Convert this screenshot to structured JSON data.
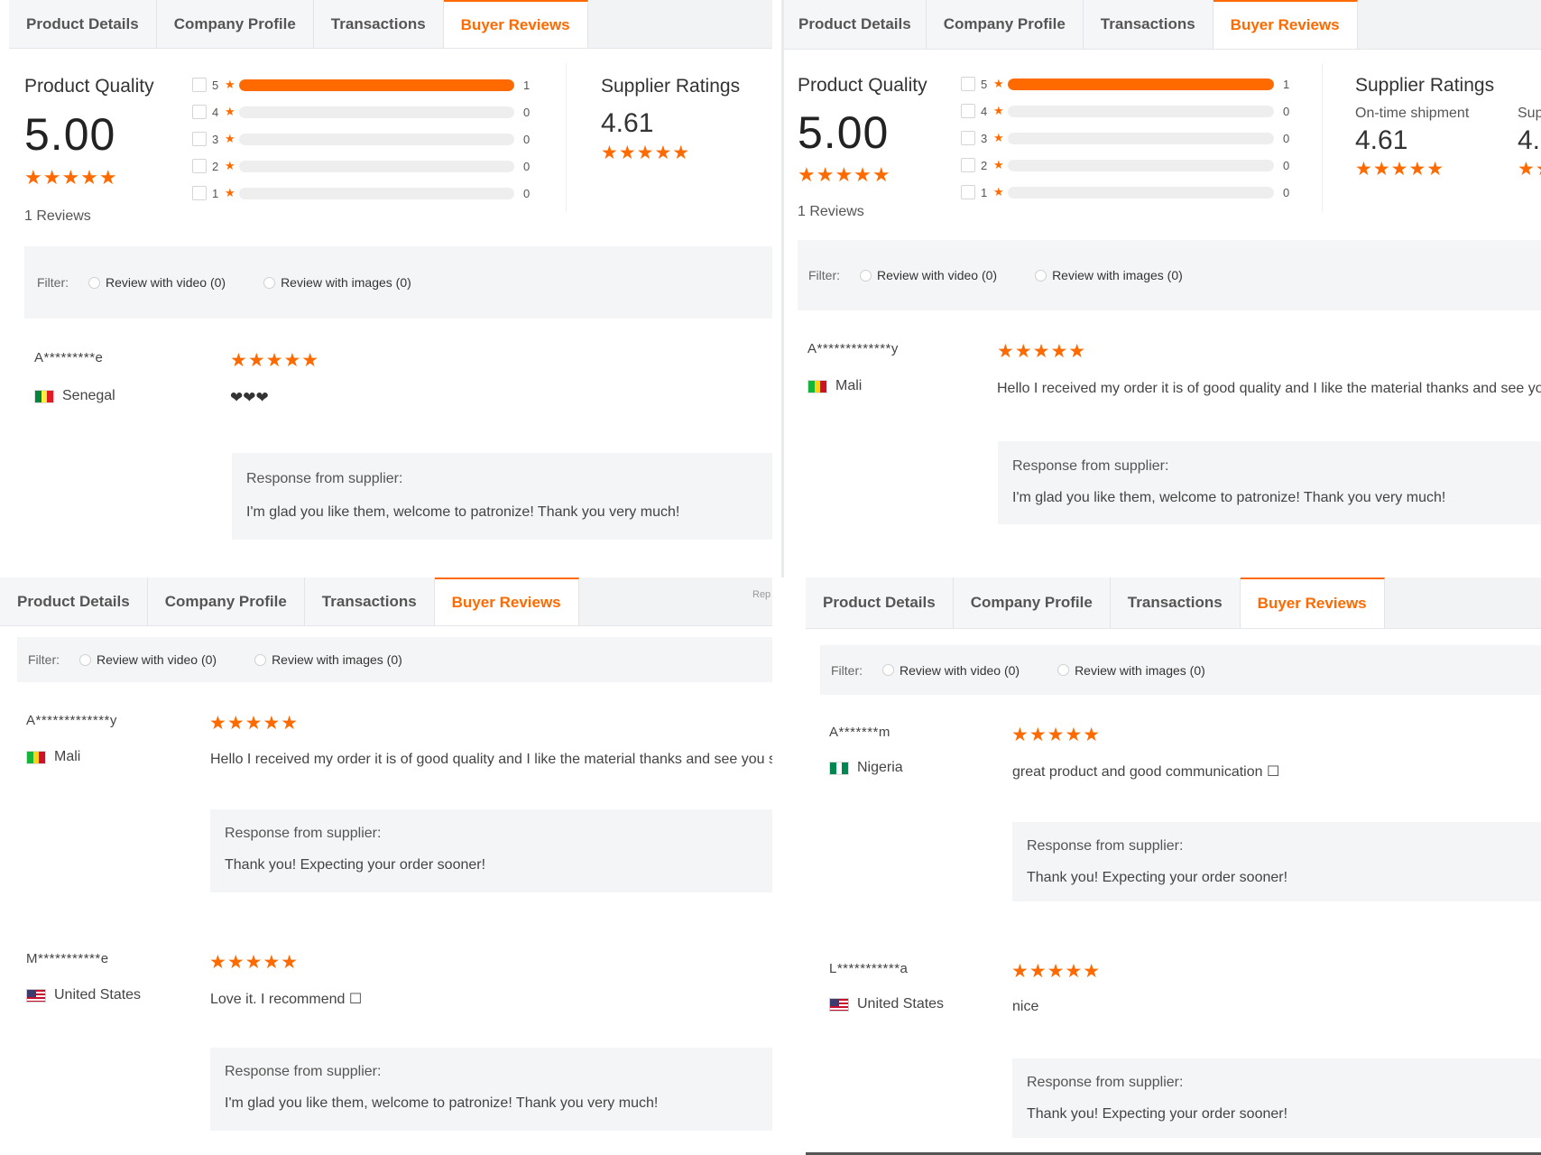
{
  "tabs": [
    "Product Details",
    "Company Profile",
    "Transactions",
    "Buyer Reviews"
  ],
  "colors": {
    "accent": "#ff6a00",
    "panel_bg": "#f4f5f7"
  },
  "icons": {
    "star": "star-icon",
    "heart": "heart-icon",
    "flag": "flag-icon"
  },
  "product_quality": {
    "title": "Product Quality",
    "score": "5.00",
    "reviews": "1 Reviews",
    "stars": "★★★★★",
    "breakdown_tl": [
      {
        "stars": "5",
        "count": "1",
        "fraction": 1
      },
      {
        "stars": "4",
        "count": "0",
        "fraction": 0
      },
      {
        "stars": "3",
        "count": "0",
        "fraction": 0
      },
      {
        "stars": "2",
        "count": "0",
        "fraction": 0
      },
      {
        "stars": "1",
        "count": "0",
        "fraction": 0
      }
    ]
  },
  "supplier_ratings": {
    "title": "Supplier Ratings",
    "on_time_label": "On-time shipment",
    "score": "4.61",
    "clipped_label": "Sup",
    "clipped_score": "4."
  },
  "filter": {
    "label": "Filter:",
    "video": "Review with video (0)",
    "images": "Review with images (0)"
  },
  "reply_clipped": "Rep",
  "response_title": "Response from supplier:",
  "reviews": {
    "senegal": {
      "name": "A*********e",
      "country": "Senegal",
      "stars": "★★★★★",
      "text": "❤❤❤",
      "response": "I'm glad you like them, welcome to patronize! Thank you very much!"
    },
    "mali": {
      "name": "A*************y",
      "country": "Mali",
      "stars": "★★★★★",
      "text": "Hello I received my order it is of good quality and I like the material thanks and see you soon",
      "response_tr": "I'm glad you like them, welcome to patronize! Thank you very much!",
      "response_bl": "Thank you! Expecting your order sooner!"
    },
    "us_m": {
      "name": "M***********e",
      "country": "United States",
      "stars": "★★★★★",
      "text": "Love it. I recommend ☐",
      "response": "I'm glad you like them, welcome to patronize! Thank you very much!"
    },
    "nigeria": {
      "name": "A*******m",
      "country": "Nigeria",
      "stars": "★★★★★",
      "text": "great product and good communication ☐",
      "response": "Thank you! Expecting your order sooner!"
    },
    "us_l": {
      "name": "L***********a",
      "country": "United States",
      "stars": "★★★★★",
      "text": "nice",
      "response": "Thank you! Expecting your order sooner!"
    }
  }
}
